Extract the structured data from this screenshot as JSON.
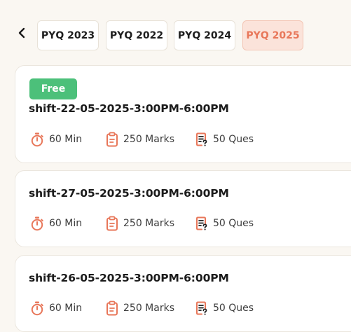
{
  "header": {
    "tabs": [
      {
        "label": "PYQ 2023",
        "active": false
      },
      {
        "label": "PYQ 2022",
        "active": false
      },
      {
        "label": "PYQ 2024",
        "active": false
      },
      {
        "label": "PYQ 2025",
        "active": true
      }
    ]
  },
  "papers": [
    {
      "badge": "Free",
      "title": "shift-22-05-2025-3:00PM-6:00PM",
      "duration": "60 Min",
      "marks": "250 Marks",
      "questions": "50 Ques"
    },
    {
      "badge": "",
      "title": "shift-27-05-2025-3:00PM-6:00PM",
      "duration": "60 Min",
      "marks": "250 Marks",
      "questions": "50 Ques"
    },
    {
      "badge": "",
      "title": "shift-26-05-2025-3:00PM-6:00PM",
      "duration": "60 Min",
      "marks": "250 Marks",
      "questions": "50 Ques"
    }
  ],
  "colors": {
    "accent": "#e8775a",
    "active_tab_bg": "#fbe3da",
    "free_badge": "#4cc07a",
    "page_bg": "#faf7f2"
  },
  "icons": {
    "back": "chevron-left-icon",
    "duration": "stopwatch-icon",
    "marks": "clipboard-icon",
    "questions": "question-list-icon"
  }
}
